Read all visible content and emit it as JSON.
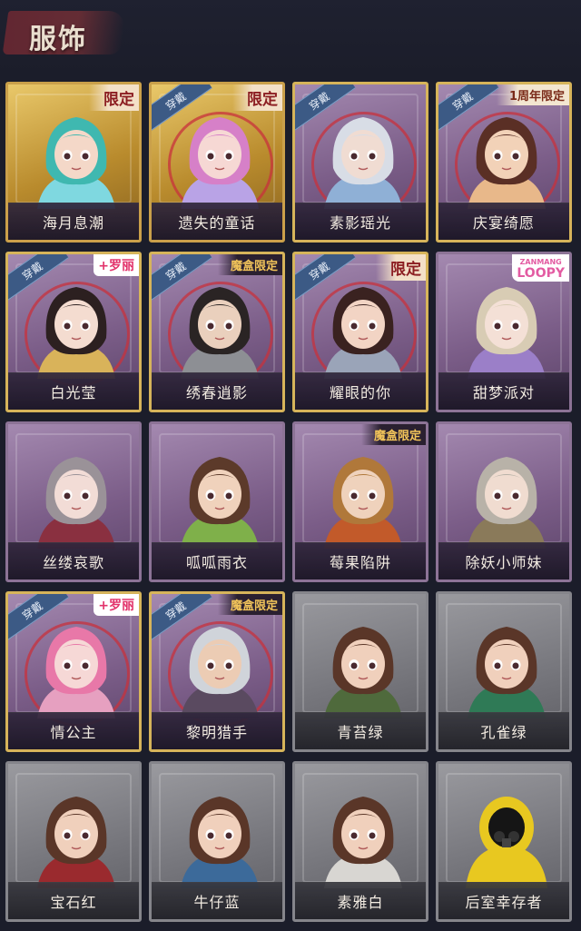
{
  "header": {
    "title": "服饰"
  },
  "labels": {
    "worn": "穿戴"
  },
  "items": [
    {
      "name": "海月息潮",
      "frame": "gold",
      "worn": false,
      "tag": "limited",
      "tag_text": "限定",
      "palette": {
        "hair": "#3fb8b0",
        "skin": "#f4d8c8",
        "accent": "#7fd8e0"
      }
    },
    {
      "name": "遗失的童话",
      "frame": "gold",
      "worn": true,
      "tag": "limited",
      "tag_text": "限定",
      "palette": {
        "hair": "#d680c8",
        "skin": "#f6d8d4",
        "accent": "#b9a3e6"
      }
    },
    {
      "name": "素影瑶光",
      "frame": "purple",
      "worn": true,
      "tag": "",
      "tag_text": "",
      "palette": {
        "hair": "#d8dde6",
        "skin": "#f0dcd2",
        "accent": "#8fb0d6"
      }
    },
    {
      "name": "庆宴绮愿",
      "frame": "purple",
      "worn": true,
      "tag": "anniv",
      "tag_text": "1周年限定",
      "palette": {
        "hair": "#5a2f25",
        "skin": "#f2d2b8",
        "accent": "#e8b88a"
      }
    },
    {
      "name": "白光莹",
      "frame": "purple",
      "worn": true,
      "tag": "lolita",
      "tag_text": "+罗丽",
      "palette": {
        "hair": "#2c2020",
        "skin": "#f4dcd0",
        "accent": "#d9b35a"
      }
    },
    {
      "name": "绣春逍影",
      "frame": "purple",
      "worn": true,
      "tag": "box",
      "tag_text": "魔盒限定",
      "palette": {
        "hair": "#2a2424",
        "skin": "#ead0bd",
        "accent": "#8d8f94"
      }
    },
    {
      "name": "耀眼的你",
      "frame": "purple",
      "worn": true,
      "tag": "limited",
      "tag_text": "限定",
      "palette": {
        "hair": "#3a2220",
        "skin": "#f2d4c4",
        "accent": "#9aa4b8"
      }
    },
    {
      "name": "甜梦派对",
      "frame": "purple",
      "worn": false,
      "tag": "loopy",
      "tag_text": "LOOPY",
      "tag_sub": "ZANMANG",
      "palette": {
        "hair": "#d8ccb4",
        "skin": "#f4e0d6",
        "accent": "#9b7fc8"
      }
    },
    {
      "name": "丝缕哀歌",
      "frame": "purple",
      "worn": false,
      "tag": "",
      "tag_text": "",
      "palette": {
        "hair": "#9a9298",
        "skin": "#f2dcd6",
        "accent": "#8a3040"
      }
    },
    {
      "name": "呱呱雨衣",
      "frame": "purple",
      "worn": false,
      "tag": "",
      "tag_text": "",
      "palette": {
        "hair": "#5c3a2a",
        "skin": "#f0d2bc",
        "accent": "#7fb04a"
      }
    },
    {
      "name": "莓果陷阱",
      "frame": "purple",
      "worn": false,
      "tag": "box",
      "tag_text": "魔盒限定",
      "palette": {
        "hair": "#b0783a",
        "skin": "#efd2bc",
        "accent": "#c25a2a"
      }
    },
    {
      "name": "除妖小师妹",
      "frame": "purple",
      "worn": false,
      "tag": "",
      "tag_text": "",
      "palette": {
        "hair": "#b8b2a8",
        "skin": "#f0dcd0",
        "accent": "#8a7a5a"
      }
    },
    {
      "name": "情公主",
      "frame": "purple",
      "worn": true,
      "tag": "lolita",
      "tag_text": "+罗丽",
      "palette": {
        "hair": "#e878a8",
        "skin": "#f6d8d6",
        "accent": "#e6a0c0"
      }
    },
    {
      "name": "黎明猎手",
      "frame": "purple",
      "worn": true,
      "tag": "box",
      "tag_text": "魔盒限定",
      "palette": {
        "hair": "#d0d4da",
        "skin": "#ecccb4",
        "accent": "#5a4a60"
      }
    },
    {
      "name": "青苔绿",
      "frame": "gray",
      "worn": false,
      "tag": "",
      "tag_text": "",
      "palette": {
        "hair": "#5a3628",
        "skin": "#f0d0bc",
        "accent": "#4f6a3c"
      }
    },
    {
      "name": "孔雀绿",
      "frame": "gray",
      "worn": false,
      "tag": "",
      "tag_text": "",
      "palette": {
        "hair": "#5a3628",
        "skin": "#f0d0bc",
        "accent": "#2f7a56"
      }
    },
    {
      "name": "宝石红",
      "frame": "gray",
      "worn": false,
      "tag": "",
      "tag_text": "",
      "palette": {
        "hair": "#5a3628",
        "skin": "#f0d0bc",
        "accent": "#9a2a2e"
      }
    },
    {
      "name": "牛仔蓝",
      "frame": "gray",
      "worn": false,
      "tag": "",
      "tag_text": "",
      "palette": {
        "hair": "#5a3628",
        "skin": "#f0d0bc",
        "accent": "#3c6a9a"
      }
    },
    {
      "name": "素雅白",
      "frame": "gray",
      "worn": false,
      "tag": "",
      "tag_text": "",
      "palette": {
        "hair": "#5a3628",
        "skin": "#f0d0bc",
        "accent": "#d8d6d2"
      }
    },
    {
      "name": "后室幸存者",
      "frame": "gray",
      "worn": false,
      "tag": "",
      "tag_text": "",
      "hazmat": true,
      "palette": {
        "hair": "#e8c820",
        "skin": "#1a1a1a",
        "accent": "#e8c820"
      }
    }
  ]
}
